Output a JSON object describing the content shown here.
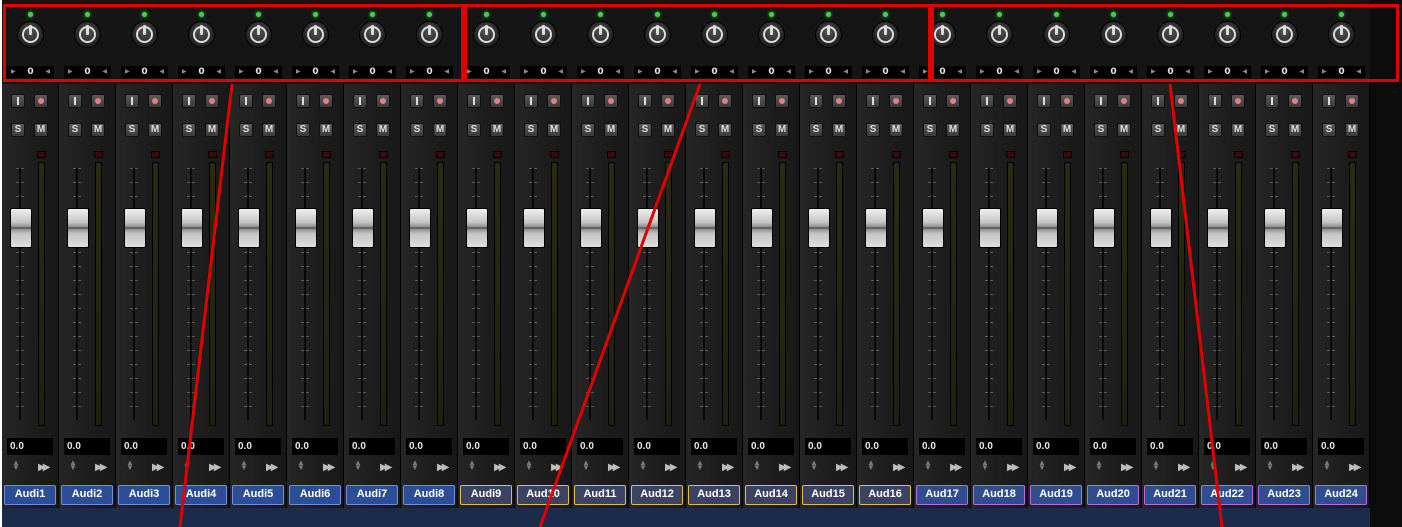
{
  "mixer": {
    "channels": [
      {
        "name": "Audi1",
        "pan": "0",
        "volume": "0.0",
        "color": "blue"
      },
      {
        "name": "Audi2",
        "pan": "0",
        "volume": "0.0",
        "color": "blue"
      },
      {
        "name": "Audi3",
        "pan": "0",
        "volume": "0.0",
        "color": "blue"
      },
      {
        "name": "Audi4",
        "pan": "0",
        "volume": "0.0",
        "color": "blue"
      },
      {
        "name": "Audi5",
        "pan": "0",
        "volume": "0.0",
        "color": "blue"
      },
      {
        "name": "Audi6",
        "pan": "0",
        "volume": "0.0",
        "color": "blue"
      },
      {
        "name": "Audi7",
        "pan": "0",
        "volume": "0.0",
        "color": "blue"
      },
      {
        "name": "Audi8",
        "pan": "0",
        "volume": "0.0",
        "color": "blue"
      },
      {
        "name": "Audi9",
        "pan": "0",
        "volume": "0.0",
        "color": "yellow"
      },
      {
        "name": "Aud10",
        "pan": "0",
        "volume": "0.0",
        "color": "yellow"
      },
      {
        "name": "Aud11",
        "pan": "0",
        "volume": "0.0",
        "color": "yellow"
      },
      {
        "name": "Aud12",
        "pan": "0",
        "volume": "0.0",
        "color": "yellow"
      },
      {
        "name": "Aud13",
        "pan": "0",
        "volume": "0.0",
        "color": "yellow"
      },
      {
        "name": "Aud14",
        "pan": "0",
        "volume": "0.0",
        "color": "yellow"
      },
      {
        "name": "Aud15",
        "pan": "0",
        "volume": "0.0",
        "color": "yellow"
      },
      {
        "name": "Aud16",
        "pan": "0",
        "volume": "0.0",
        "color": "yellow"
      },
      {
        "name": "Aud17",
        "pan": "0",
        "volume": "0.0",
        "color": "purple"
      },
      {
        "name": "Aud18",
        "pan": "0",
        "volume": "0.0",
        "color": "purple"
      },
      {
        "name": "Aud19",
        "pan": "0",
        "volume": "0.0",
        "color": "purple"
      },
      {
        "name": "Aud20",
        "pan": "0",
        "volume": "0.0",
        "color": "purple"
      },
      {
        "name": "Aud21",
        "pan": "0",
        "volume": "0.0",
        "color": "purple"
      },
      {
        "name": "Aud22",
        "pan": "0",
        "volume": "0.0",
        "color": "purple"
      },
      {
        "name": "Aud23",
        "pan": "0",
        "volume": "0.0",
        "color": "purple"
      },
      {
        "name": "Aud24",
        "pan": "0",
        "volume": "0.0",
        "color": "purple"
      }
    ],
    "buttons": {
      "input": "I",
      "solo": "S",
      "mute": "M"
    },
    "colors": {
      "blue": "#2d4e96",
      "yellow": "#d8c24b",
      "purple": "#b46ddb",
      "highlight": "#e00000",
      "pan_led": "#3fd44a"
    }
  }
}
